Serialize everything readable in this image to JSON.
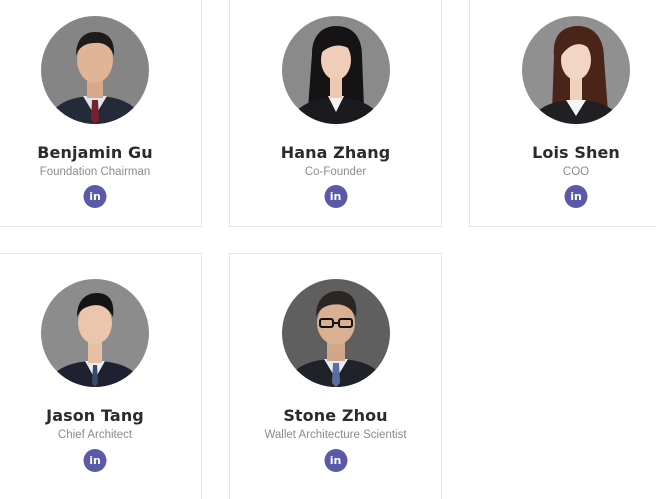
{
  "team": [
    {
      "name": "Benjamin Gu",
      "role": "Foundation Chairman",
      "linkedin_label": "in"
    },
    {
      "name": "Hana Zhang",
      "role": "Co-Founder",
      "linkedin_label": "in"
    },
    {
      "name": "Lois Shen",
      "role": "COO",
      "linkedin_label": "in"
    },
    {
      "name": "Jason Tang",
      "role": "Chief Architect",
      "linkedin_label": "in"
    },
    {
      "name": "Stone Zhou",
      "role": "Wallet Architecture Scientist",
      "linkedin_label": "in"
    }
  ],
  "icons": {
    "linkedin": "linkedin-icon"
  },
  "colors": {
    "linkedin_button": "#5b5aa8",
    "name_text": "#2b2b2b",
    "role_text": "#8b8b8b",
    "card_border": "#e6e6e6",
    "photo_background": "#7d7d7d"
  }
}
